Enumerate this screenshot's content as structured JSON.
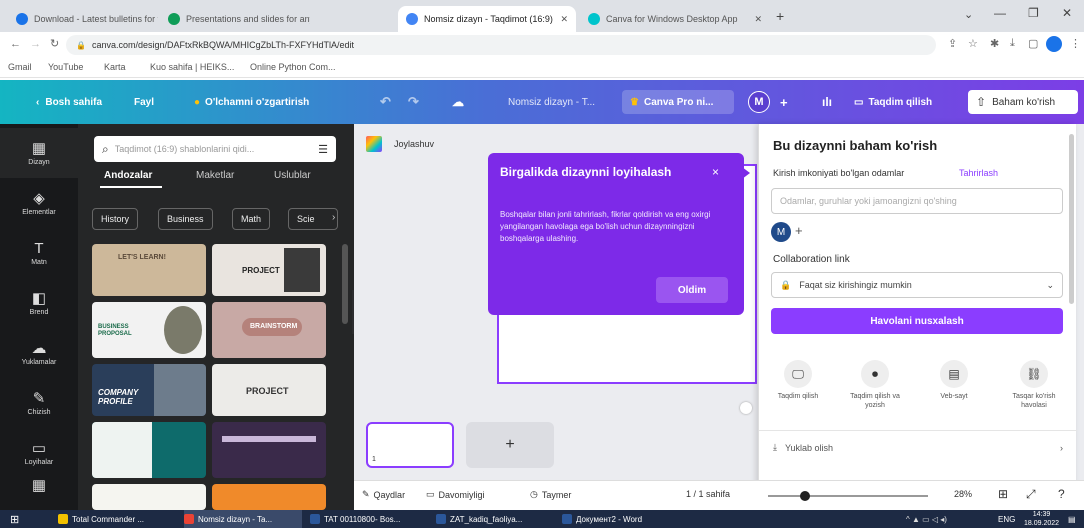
{
  "browser": {
    "tabs": [
      {
        "title": "Download - Latest bulletins for t...",
        "favicon_color": "#1a73e8"
      },
      {
        "title": "Presentations and slides for any...",
        "favicon_color": "#0f9d58"
      },
      {
        "title": "Nomsiz dizayn - Taqdimot (16:9)",
        "favicon_color": "#4285f4"
      },
      {
        "title": "Canva for Windows Desktop App",
        "favicon_color": "#00c4cc"
      }
    ],
    "new_tab": "+",
    "address": "canva.com/design/DAFtxRkBQWA/MHICgZbLTh-FXFYHdTlA/edit",
    "bookmarks": [
      "Gmail",
      "YouTube",
      "Karta",
      "Kuo sahifa | HEIKS...",
      "Online Python Com..."
    ]
  },
  "header": {
    "back": "Bosh sahifa",
    "file": "Fayl",
    "resize": "O'lchamni o'zgartirish",
    "doc_title": "Nomsiz dizayn - T...",
    "pro": "Canva Pro ni...",
    "avatar": "M",
    "present": "Taqdim qilish",
    "share": "Baham ko'rish"
  },
  "rail": [
    {
      "label": "Dizayn",
      "icon": "design-icon",
      "glyph": "▦"
    },
    {
      "label": "Elementlar",
      "icon": "elements-icon",
      "glyph": "◈"
    },
    {
      "label": "Matn",
      "icon": "text-icon",
      "glyph": "T"
    },
    {
      "label": "Brend",
      "icon": "brand-icon",
      "glyph": "◧"
    },
    {
      "label": "Yuklamalar",
      "icon": "uploads-icon",
      "glyph": "☁"
    },
    {
      "label": "Chizish",
      "icon": "draw-icon",
      "glyph": "✎"
    },
    {
      "label": "Loyihalar",
      "icon": "projects-icon",
      "glyph": "▭"
    },
    {
      "label": "",
      "icon": "apps-icon",
      "glyph": "▦"
    }
  ],
  "panel": {
    "search_placeholder": "Taqdimot (16:9) shablonlarini qidi...",
    "categories": [
      "Andozalar",
      "Maketlar",
      "Uslublar"
    ],
    "chips": [
      "History",
      "Business",
      "Math",
      "Scie"
    ],
    "thumbs": [
      {
        "text": "LET'S LEARN!",
        "bg": "#cdb89a",
        "fg": "#5b4a3a"
      },
      {
        "text": "PROJECT",
        "bg": "#e9e4df",
        "fg": "#222"
      },
      {
        "text": "BUSINESS PROPOSAL",
        "bg": "#f2f2f2",
        "fg": "#1a6b4a"
      },
      {
        "text": "BRAINSTORM",
        "bg": "#c8a9a5",
        "fg": "#fff"
      },
      {
        "text": "COMPANY PROFILE",
        "bg": "#2a3e5a",
        "fg": "#fff"
      },
      {
        "text": "PROJECT",
        "bg": "#ecebe8",
        "fg": "#333"
      },
      {
        "text": "",
        "bg": "#0e6b6b",
        "fg": "#fff"
      },
      {
        "text": "",
        "bg": "#3a2a4a",
        "fg": "#fff"
      },
      {
        "text": "",
        "bg": "#f5f5f0",
        "fg": "#333"
      },
      {
        "text": "",
        "bg": "#f08a2a",
        "fg": "#fff"
      }
    ]
  },
  "canvas": {
    "page_label": "Joylashuv",
    "add_page": "+"
  },
  "tooltip": {
    "title": "Birgalikda dizaynni loyihalash",
    "body": "Boshqalar bilan jonli tahrirlash, fikrlar qoldirish va eng oxirgi yangilangan havolaga ega bo'lish uchun dizaynningizni boshqalarga ulashing.",
    "button": "Oldim",
    "close": "×"
  },
  "share": {
    "title": "Bu dizaynni baham ko'rish",
    "access_label": "Kirish imkoniyati bo'lgan odamlar",
    "edit_link": "Tahrirlash",
    "input_placeholder": "Odamlar, guruhlar yoki jamoangizni qo'shing",
    "avatar": "M",
    "collab_label": "Collaboration link",
    "link_option": "Faqat siz kirishingiz mumkin",
    "copy_button": "Havolani nusxalash",
    "actions": [
      {
        "label": "Taqdim qilish",
        "icon": "present-icon",
        "glyph": "🖵"
      },
      {
        "label": "Taqdim qilish va yozish",
        "icon": "record-icon",
        "glyph": "⏺"
      },
      {
        "label": "Veb-sayt",
        "icon": "website-icon",
        "glyph": "▤"
      },
      {
        "label": "Tasqar ko'rish havolasi",
        "icon": "link-icon",
        "glyph": "⛓"
      }
    ],
    "download": "Yuklab olish"
  },
  "footer": {
    "notes": "Qaydlar",
    "duration": "Davomiyligi",
    "timer": "Taymer",
    "pages": "1 / 1 sahifa",
    "zoom": "28%",
    "zoom_level": 0.2
  },
  "taskbar": {
    "items": [
      {
        "label": "Total Commander ...",
        "color": "#f2c100"
      },
      {
        "label": "Nomsiz dizayn - Ta...",
        "color": "#ea4335"
      },
      {
        "label": "TAT 00110800- Bos...",
        "color": "#2b579a"
      },
      {
        "label": "ZAT_kadiq_faoliya...",
        "color": "#2b579a"
      },
      {
        "label": "Документ2 - Word",
        "color": "#2b579a"
      }
    ],
    "time": "14:39",
    "date": "18.09.2022",
    "lang": "ENG"
  },
  "colors": {
    "canva_purple": "#8b3dff",
    "tooltip_purple": "#7d2ae8",
    "rail_bg": "#18191b",
    "panel_bg": "#252627"
  }
}
